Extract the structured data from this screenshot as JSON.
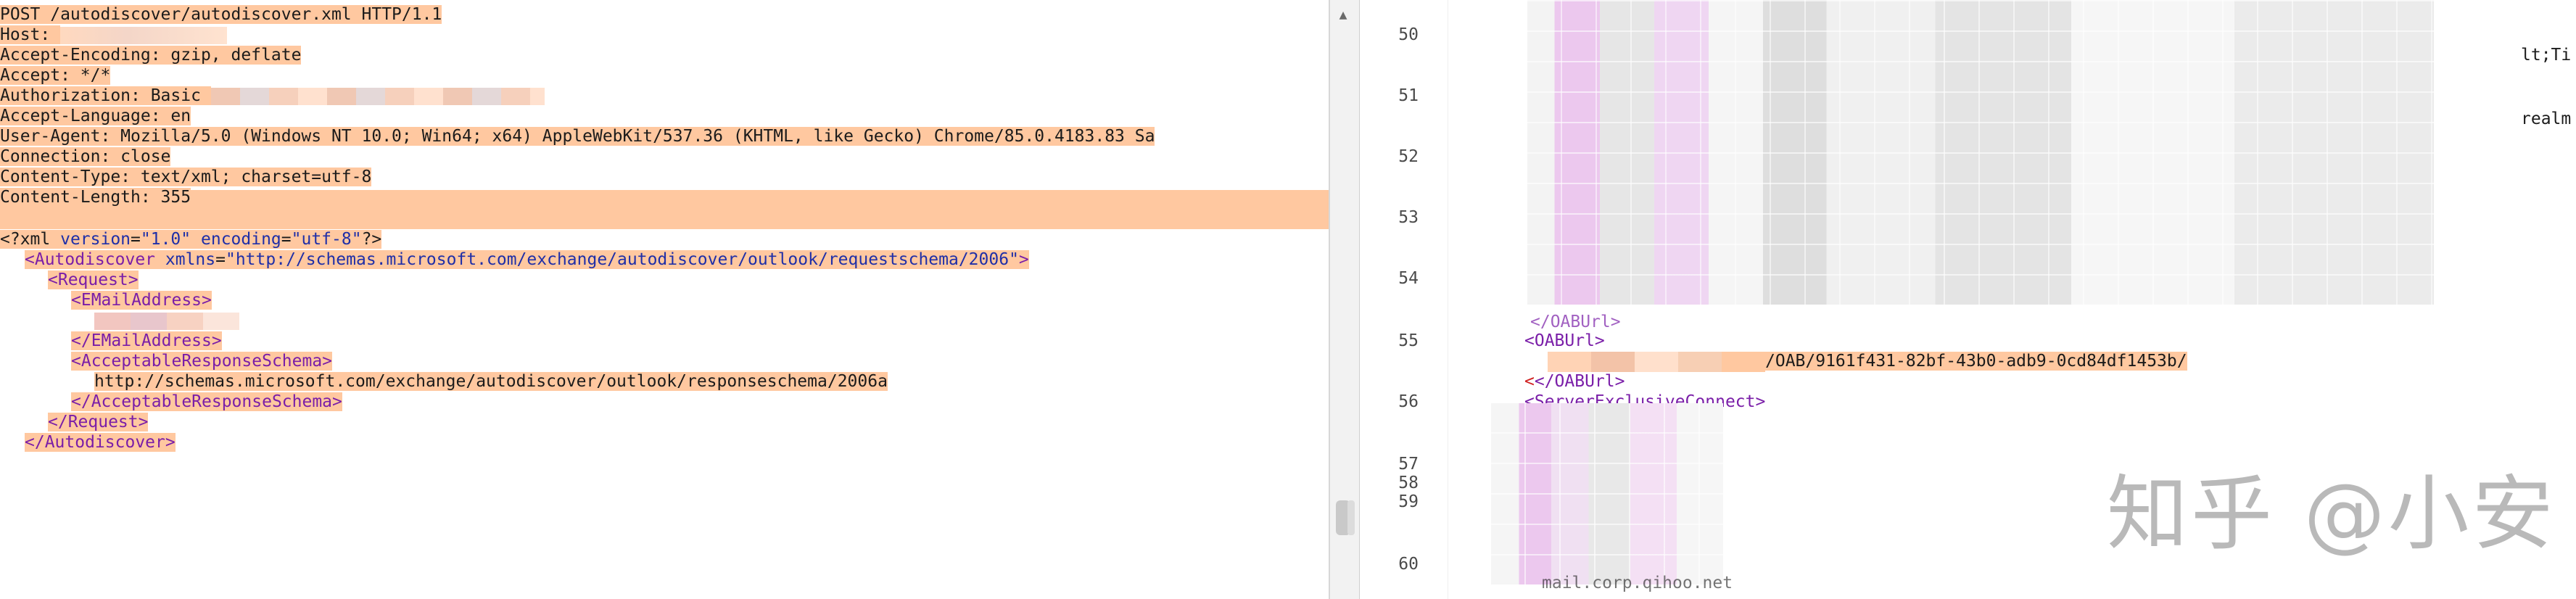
{
  "request": {
    "lines": [
      "POST /autodiscover/autodiscover.xml HTTP/1.1",
      "Host: ",
      "Accept-Encoding: gzip, deflate",
      "Accept: */*",
      "Authorization: Basic ",
      "Accept-Language: en",
      "User-Agent: Mozilla/5.0 (Windows NT 10.0; Win64; x64) AppleWebKit/537.36 (KHTML, like Gecko) Chrome/85.0.4183.83 Sa",
      "Connection: close",
      "Content-Type: text/xml; charset=utf-8",
      "Content-Length: 355"
    ],
    "xml": {
      "pi_open": "<?xml ",
      "pi_version_attr": "version",
      "pi_version_val": "\"1.0\"",
      "pi_encoding_attr": "encoding",
      "pi_encoding_val": "\"utf-8\"",
      "pi_close": "?>",
      "autodiscover_open": "<Autodiscover ",
      "xmlns_attr": "xmlns",
      "xmlns_val": "\"http://schemas.microsoft.com/exchange/autodiscover/outlook/requestschema/2006\"",
      "autodiscover_open_close": ">",
      "request_open": "<Request>",
      "email_open": "<EMailAddress>",
      "email_close": "</EMailAddress>",
      "schema_open": "<AcceptableResponseSchema>",
      "schema_value": "http://schemas.microsoft.com/exchange/autodiscover/outlook/responseschema/2006a",
      "schema_close": "</AcceptableResponseSchema>",
      "request_close": "</Request>",
      "autodiscover_close": "</Autodiscover>"
    }
  },
  "scrollbar": {
    "up_arrow": "▲"
  },
  "response": {
    "line_numbers": [
      "50",
      "51",
      "52",
      "53",
      "54",
      "55",
      "56",
      "57",
      "58",
      "59",
      "60"
    ],
    "text_lt": "lt;Ti",
    "text_realm": "realm",
    "oab_close_partial": "</OABUrl>",
    "oab_open": "<OABUrl>",
    "oab_value": "/OAB/9161f431-82bf-43b0-adb9-0cd84df1453b/",
    "oab_close": "</OABUrl>",
    "server_exclusive": "<ServerExclusiveConnect>",
    "bottom_partial": "mail.corp.qihoo.net"
  },
  "watermark": "知乎 @小安",
  "colors": {
    "selection": "#ffc8a0",
    "xml_tag": "#7a1ea8",
    "xml_attr": "#1f2fa8",
    "mosaic_purple": "#ecc8ee",
    "mosaic_gray": "#dcdcdc"
  }
}
